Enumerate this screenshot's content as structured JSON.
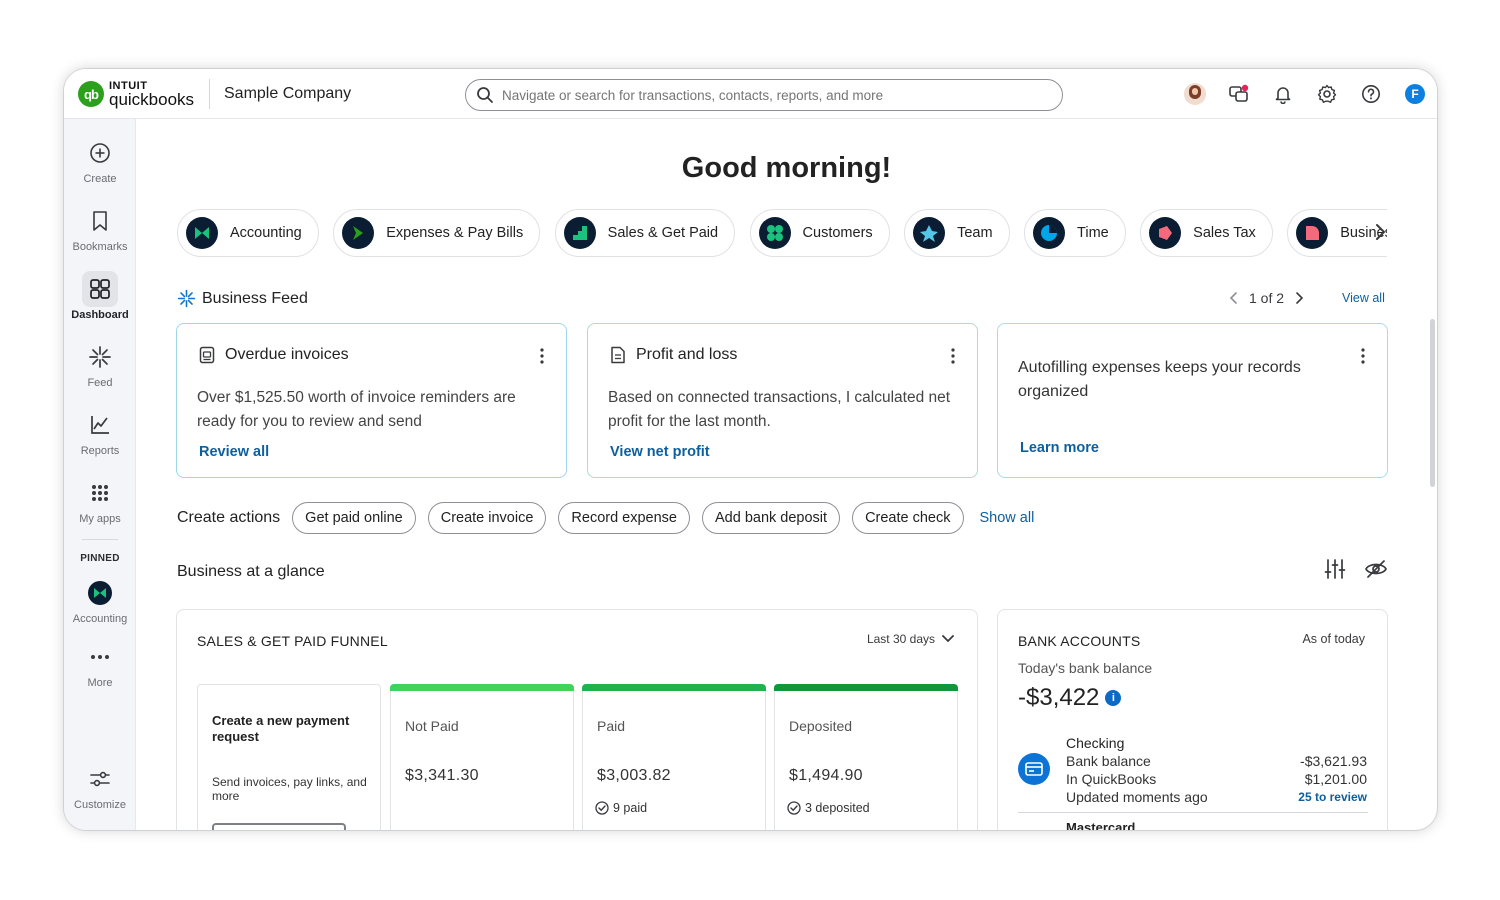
{
  "header": {
    "logo_intuit": "INTUIT",
    "logo_product": "quickbooks",
    "logo_mark": "qb",
    "company": "Sample Company",
    "search_placeholder": "Navigate or search for transactions, contacts, reports, and more",
    "profile_initial": "F",
    "icons": [
      "avatar",
      "chat-icon",
      "bell-icon",
      "gear-icon",
      "help-icon",
      "profile-icon"
    ]
  },
  "sidebar": {
    "items": [
      {
        "label": "Create",
        "icon": "plus-circle-icon"
      },
      {
        "label": "Bookmarks",
        "icon": "bookmark-icon"
      },
      {
        "label": "Dashboard",
        "icon": "dashboard-icon",
        "active": true
      },
      {
        "label": "Feed",
        "icon": "feed-icon"
      },
      {
        "label": "Reports",
        "icon": "reports-icon"
      },
      {
        "label": "My apps",
        "icon": "apps-icon"
      }
    ],
    "pinned_label": "PINNED",
    "pinned": [
      {
        "label": "Accounting",
        "icon": "accounting-icon"
      },
      {
        "label": "More",
        "icon": "more-icon"
      }
    ],
    "customize": "Customize"
  },
  "main": {
    "greeting": "Good morning!",
    "chips": [
      {
        "label": "Accounting",
        "color": "#19c37d"
      },
      {
        "label": "Expenses & Pay Bills",
        "color": "#2ca01c"
      },
      {
        "label": "Sales & Get Paid",
        "color": "#19c37d"
      },
      {
        "label": "Customers",
        "color": "#19c37d"
      },
      {
        "label": "Team",
        "color": "#54c6e8"
      },
      {
        "label": "Time",
        "color": "#00a6e8"
      },
      {
        "label": "Sales Tax",
        "color": "#f46a7d"
      },
      {
        "label": "Business Tax",
        "color": "#f46a7d"
      }
    ],
    "feed": {
      "title": "Business Feed",
      "pager": "1 of 2",
      "view_all": "View all",
      "cards": [
        {
          "title": "Overdue invoices",
          "body": "Over $1,525.50 worth of invoice reminders are ready for you to review and send",
          "link": "Review all"
        },
        {
          "title": "Profit and loss",
          "body": "Based on connected transactions, I calculated net profit for the last month.",
          "link": "View net profit"
        },
        {
          "title": "",
          "body": "Autofilling expenses keeps your records organized",
          "link": "Learn more"
        }
      ]
    },
    "create_actions": {
      "label": "Create actions",
      "buttons": [
        "Get paid online",
        "Create invoice",
        "Record expense",
        "Add bank deposit",
        "Create check"
      ],
      "show_all": "Show all"
    },
    "glance": {
      "title": "Business at a glance",
      "funnel": {
        "title": "SALES & GET PAID FUNNEL",
        "range": "Last 30 days",
        "create": {
          "title": "Create a new payment request",
          "desc": "Send invoices, pay links, and more"
        },
        "stages": [
          {
            "label": "Not Paid",
            "value": "$3,341.30",
            "sub": "",
            "color": "#3fd35e"
          },
          {
            "label": "Paid",
            "value": "$3,003.82",
            "sub": "9 paid",
            "color": "#20b24c"
          },
          {
            "label": "Deposited",
            "value": "$1,494.90",
            "sub": "3 deposited",
            "color": "#11963a"
          }
        ]
      },
      "bank": {
        "title": "BANK ACCOUNTS",
        "as_of": "As of today",
        "subtitle": "Today's bank balance",
        "amount": "-$3,422",
        "info": "i",
        "account": {
          "name": "Checking",
          "line1": "Bank balance",
          "line2": "In QuickBooks",
          "line3": "Updated moments ago",
          "bank_balance": "-$3,621.93",
          "qb_balance": "$1,201.00",
          "review": "25 to review"
        },
        "next_account": "Mastercard"
      }
    }
  }
}
